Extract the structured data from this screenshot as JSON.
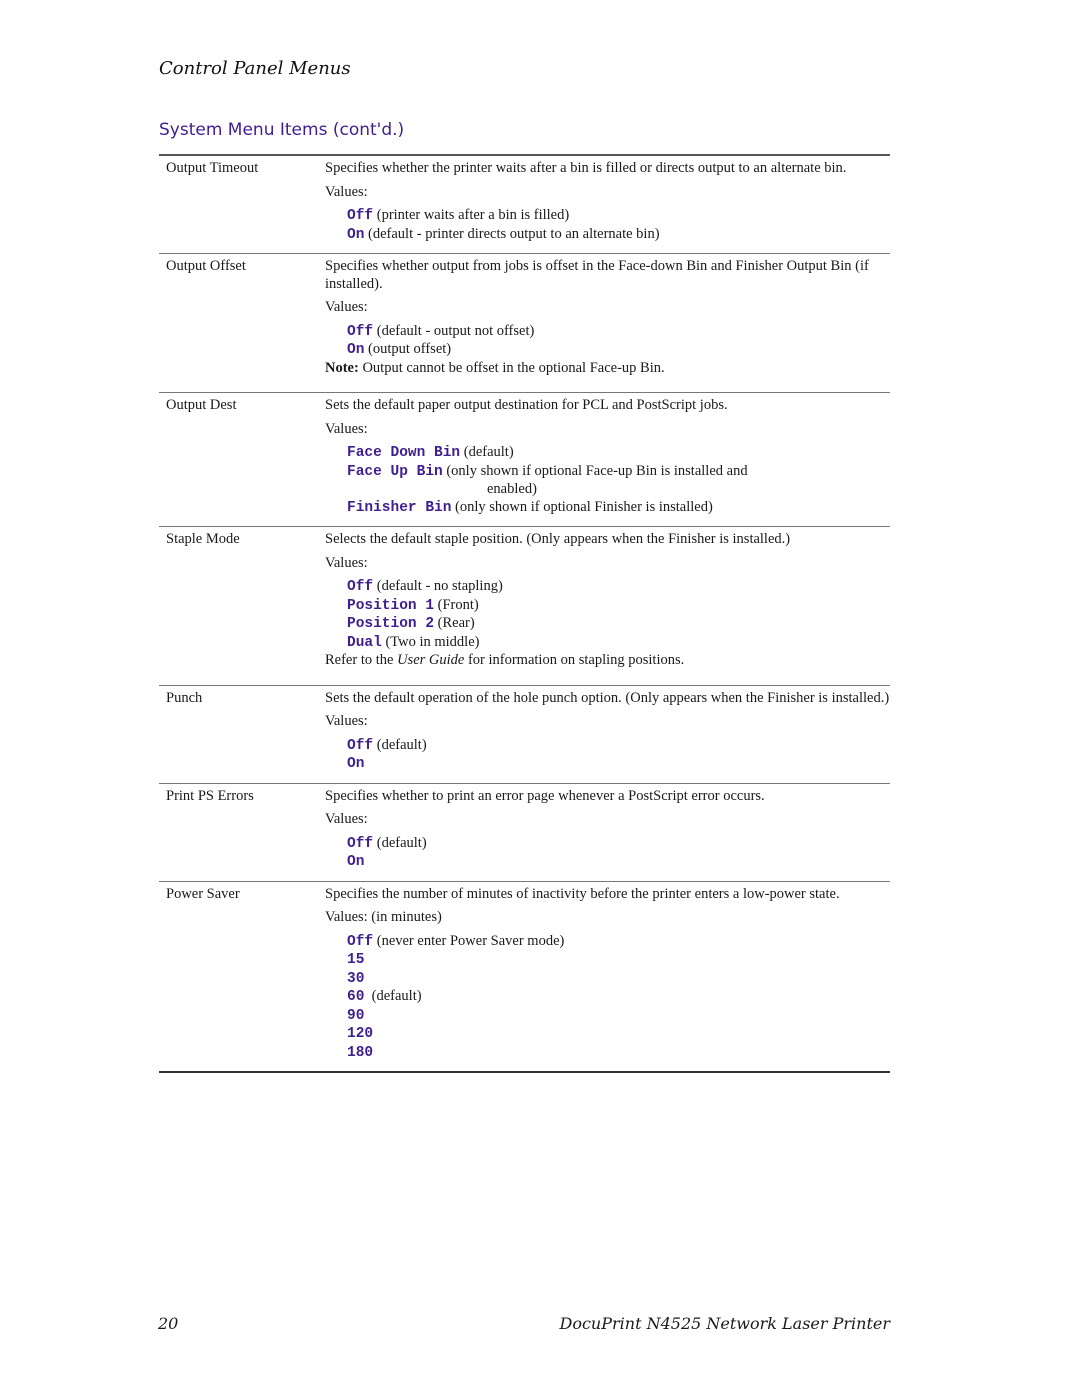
{
  "header": {
    "running_head": "Control Panel Menus",
    "section_title": "System Menu Items (cont'd.)"
  },
  "rows": [
    {
      "term": "Output Timeout",
      "description": "Specifies whether the printer waits after a bin is filled or directs output to an alternate bin.",
      "values_label": "Values:",
      "values": [
        {
          "code": "Off",
          "text": " (printer waits after a bin is filled)"
        },
        {
          "code": "On",
          "text": " (default - printer directs output to an alternate bin)"
        }
      ]
    },
    {
      "term": "Output Offset",
      "description": "Specifies whether output from jobs is offset in the Face-down Bin and Finisher Output Bin (if installed).",
      "values_label": "Values:",
      "values": [
        {
          "code": "Off",
          "text": " (default - output not offset)"
        },
        {
          "code": "On",
          "text": " (output offset)"
        }
      ],
      "note_label": "Note:",
      "note_text": " Output cannot be offset in the optional Face-up Bin."
    },
    {
      "term": "Output Dest",
      "description": "Sets the default paper output destination for PCL and PostScript jobs.",
      "values_label": "Values:",
      "values": [
        {
          "code": "Face Down Bin",
          "text": " (default)"
        },
        {
          "code": "Face Up Bin",
          "text": "(only shown if optional Face-up Bin is installed and",
          "text_cont": "enabled)"
        },
        {
          "code": "Finisher Bin",
          "text": " (only shown if optional Finisher is installed)"
        }
      ]
    },
    {
      "term": "Staple Mode",
      "description": "Selects the default staple position. (Only appears when the Finisher is installed.)",
      "values_label": "Values:",
      "values": [
        {
          "code": "Off",
          "text": " (default - no stapling)"
        },
        {
          "code": "Position 1",
          "text": " (Front)"
        },
        {
          "code": "Position 2",
          "text": " (Rear)"
        },
        {
          "code": "Dual",
          "text": " (Two in middle)"
        }
      ],
      "refer_pre": "Refer to the ",
      "refer_ital": "User Guide",
      "refer_post": " for information on stapling positions."
    },
    {
      "term": "Punch",
      "description": "Sets the default operation of the hole punch option. (Only appears when the Finisher is installed.)",
      "values_label": "Values:",
      "values": [
        {
          "code": "Off",
          "text": " (default)"
        },
        {
          "code": "On",
          "text": ""
        }
      ]
    },
    {
      "term": "Print PS Errors",
      "description": "Specifies whether to print an error page whenever a PostScript error occurs.",
      "values_label": "Values:",
      "values": [
        {
          "code": "Off",
          "text": " (default)"
        },
        {
          "code": "On",
          "text": ""
        }
      ]
    },
    {
      "term": "Power Saver",
      "description": "Specifies the number of minutes of inactivity before the printer enters a low-power state.",
      "values_label": "Values: (in minutes)",
      "values": [
        {
          "code": "Off",
          "text": " (never enter Power Saver mode)"
        },
        {
          "code": "15",
          "text": ""
        },
        {
          "code": "30",
          "text": ""
        },
        {
          "code": "60",
          "text": "  (default)"
        },
        {
          "code": "90",
          "text": ""
        },
        {
          "code": "120",
          "text": ""
        },
        {
          "code": "180",
          "text": ""
        }
      ]
    }
  ],
  "footer": {
    "page_number": "20",
    "doc_title": "DocuPrint N4525 Network Laser Printer"
  },
  "colors": {
    "accent": "#3f1f8f"
  }
}
